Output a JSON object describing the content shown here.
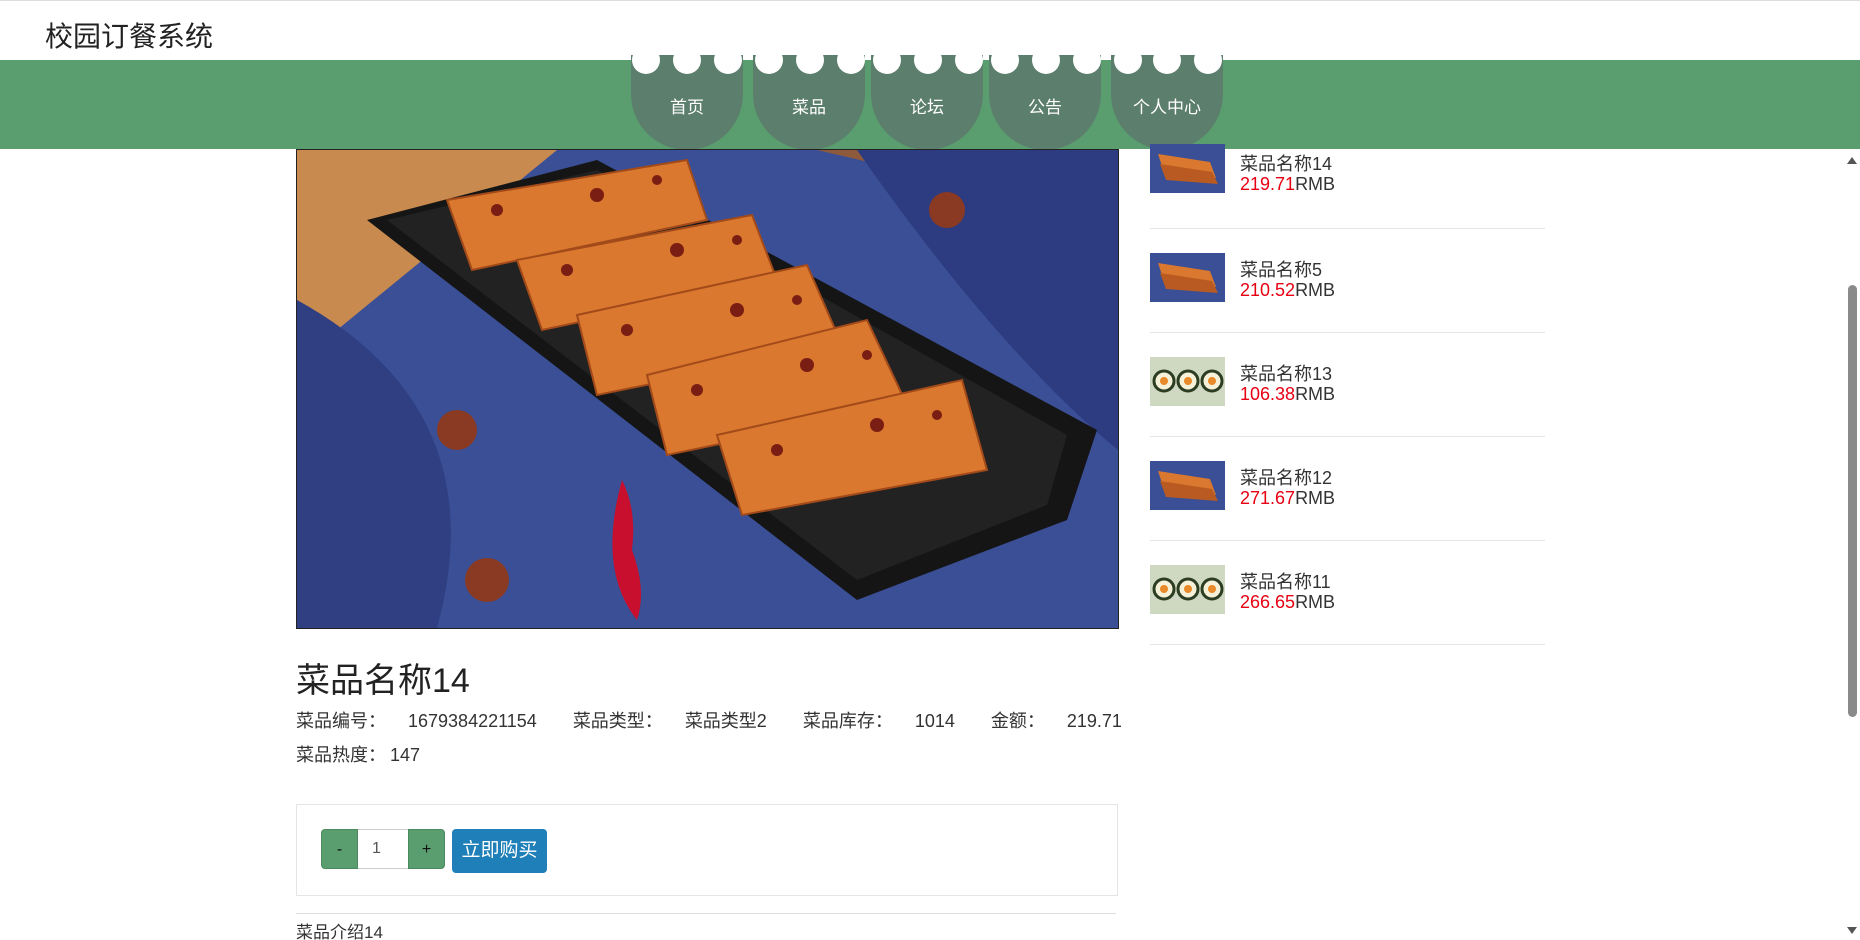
{
  "header": {
    "site_title": "校园订餐系统"
  },
  "nav": {
    "items": [
      "首页",
      "菜品",
      "论坛",
      "公告",
      "个人中心"
    ]
  },
  "dish": {
    "name": "菜品名称14",
    "meta": [
      {
        "label": "菜品编号：",
        "value": "1679384221154"
      },
      {
        "label": "菜品类型：",
        "value": "菜品类型2"
      },
      {
        "label": "菜品库存：",
        "value": "1014"
      },
      {
        "label": "金额：",
        "value": "219.71"
      },
      {
        "label": "菜品热度：",
        "value": "147"
      }
    ],
    "intro": "菜品介绍14"
  },
  "buy": {
    "minus": "-",
    "plus": "+",
    "quantity": "1",
    "buy_label": "立即购买"
  },
  "side_list": [
    {
      "name": "菜品名称14",
      "price": "219.71",
      "unit": "RMB",
      "thumb": "rice-cake-icon"
    },
    {
      "name": "菜品名称5",
      "price": "210.52",
      "unit": "RMB",
      "thumb": "rice-cake-icon"
    },
    {
      "name": "菜品名称13",
      "price": "106.38",
      "unit": "RMB",
      "thumb": "sushi-icon"
    },
    {
      "name": "菜品名称12",
      "price": "271.67",
      "unit": "RMB",
      "thumb": "rice-cake-icon"
    },
    {
      "name": "菜品名称11",
      "price": "266.65",
      "unit": "RMB",
      "thumb": "sushi-icon"
    }
  ],
  "colors": {
    "nav_band": "#5a9e6f",
    "nav_tab": "#5c7e6c",
    "price": "#e60012",
    "buy_button": "#1f7fb8"
  }
}
